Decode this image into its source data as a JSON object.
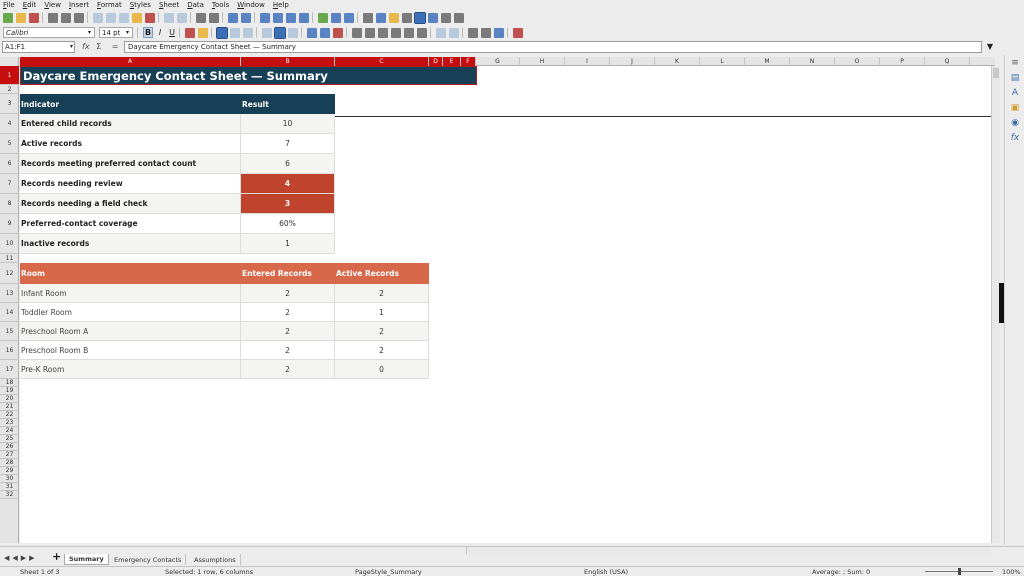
{
  "menu": [
    "File",
    "Edit",
    "View",
    "Insert",
    "Format",
    "Styles",
    "Sheet",
    "Data",
    "Tools",
    "Window",
    "Help"
  ],
  "toolbar": {
    "font_name": "Calibri",
    "font_size": "14 pt",
    "bold": "B",
    "italic": "I",
    "underline": "U"
  },
  "formula_bar": {
    "name_box": "A1:F1",
    "content": "Daycare Emergency Contact Sheet — Summary"
  },
  "columns": [
    "A",
    "B",
    "C",
    "D",
    "E",
    "F",
    "G",
    "H",
    "I",
    "J",
    "K",
    "L",
    "M",
    "N",
    "O",
    "P",
    "Q"
  ],
  "rows": [
    "1",
    "2",
    "3",
    "4",
    "5",
    "6",
    "7",
    "8",
    "9",
    "10",
    "11",
    "12",
    "13",
    "14",
    "15",
    "16",
    "17",
    "18",
    "19",
    "20",
    "21",
    "22",
    "23",
    "24",
    "25",
    "26",
    "27",
    "28",
    "29",
    "30",
    "31",
    "32"
  ],
  "sheet": {
    "title": "Daycare Emergency Contact Sheet — Summary",
    "summary_header": {
      "indicator": "Indicator",
      "result": "Result"
    },
    "summary_rows": [
      {
        "indicator": "Entered child records",
        "result": "10",
        "flag": false
      },
      {
        "indicator": "Active records",
        "result": "7",
        "flag": false
      },
      {
        "indicator": "Records meeting preferred contact count",
        "result": "6",
        "flag": false
      },
      {
        "indicator": "Records needing review",
        "result": "4",
        "flag": true
      },
      {
        "indicator": "Records needing a field check",
        "result": "3",
        "flag": true
      },
      {
        "indicator": "Preferred-contact coverage",
        "result": "60%",
        "flag": false
      },
      {
        "indicator": "Inactive records",
        "result": "1",
        "flag": false
      }
    ],
    "room_header": {
      "room": "Room",
      "entered": "Entered Records",
      "active": "Active Records"
    },
    "room_rows": [
      {
        "room": "Infant Room",
        "entered": "2",
        "active": "2"
      },
      {
        "room": "Toddler Room",
        "entered": "2",
        "active": "1"
      },
      {
        "room": "Preschool Room A",
        "entered": "2",
        "active": "2"
      },
      {
        "room": "Preschool Room B",
        "entered": "2",
        "active": "2"
      },
      {
        "room": "Pre-K Room",
        "entered": "2",
        "active": "0"
      }
    ]
  },
  "tabs": [
    "Summary",
    "Emergency Contacts",
    "Assumptions"
  ],
  "status": {
    "sheet_of": "Sheet 1 of 3",
    "selection": "Selected: 1 row, 6 columns",
    "page_style": "PageStyle_Summary",
    "language": "English (USA)",
    "aggregate": "Average: ; Sum: 0",
    "zoom": "100%"
  }
}
